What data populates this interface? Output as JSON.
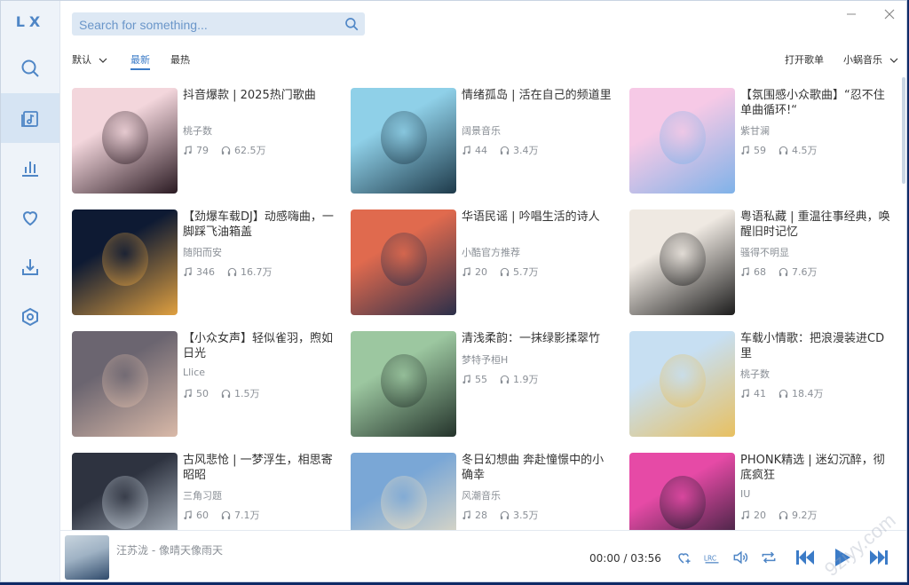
{
  "app": {
    "logo": "LX"
  },
  "sidebar": {
    "items": [
      {
        "icon": "search-icon"
      },
      {
        "icon": "song-list-icon",
        "active": true
      },
      {
        "icon": "chart-icon"
      },
      {
        "icon": "heart-icon"
      },
      {
        "icon": "download-icon"
      },
      {
        "icon": "settings-icon"
      }
    ]
  },
  "search": {
    "placeholder": "Search for something..."
  },
  "toolbar": {
    "sort_label": "默认",
    "tab_new": "最新",
    "tab_hot": "最热",
    "open_list": "打开歌单",
    "source": "小蜗音乐"
  },
  "playlists": [
    {
      "title": "抖音爆款 | 2025热门歌曲",
      "author": "桃子数",
      "songs": "79",
      "plays": "62.5万",
      "colors": [
        "#f3d6dc",
        "#2a1a22"
      ]
    },
    {
      "title": "情绪孤岛 | 活在自己的频道里",
      "author": "阔景音乐",
      "songs": "44",
      "plays": "3.4万",
      "colors": [
        "#8fd0e8",
        "#1e3a4a"
      ]
    },
    {
      "title": "【氛围感小众歌曲】“忍不住单曲循环!“",
      "author": "紫甘澜",
      "songs": "59",
      "plays": "4.5万",
      "colors": [
        "#f6c9e6",
        "#7fb2e8"
      ]
    },
    {
      "title": "【劲爆车载DJ】动感嗨曲，一脚踩飞油箱盖",
      "author": "随阳而安",
      "songs": "346",
      "plays": "16.7万",
      "colors": [
        "#0e1a33",
        "#e0a040"
      ]
    },
    {
      "title": "华语民谣 | 吟唱生活的诗人",
      "author": "小酷官方推荐",
      "songs": "20",
      "plays": "5.7万",
      "colors": [
        "#e06a4e",
        "#2b2f4a"
      ]
    },
    {
      "title": "粤语私藏 | 重温往事经典，唤醒旧时记忆",
      "author": "骚得不明显",
      "songs": "68",
      "plays": "7.6万",
      "colors": [
        "#efe9e2",
        "#1c1c1c"
      ]
    },
    {
      "title": "【小众女声】轻似雀羽，煦如日光",
      "author": "Llice",
      "songs": "50",
      "plays": "1.5万",
      "colors": [
        "#6b6570",
        "#d9b9a8"
      ]
    },
    {
      "title": "清浅柔韵：一抹绿影揉翠竹",
      "author": "梦特予桓H",
      "songs": "55",
      "plays": "1.9万",
      "colors": [
        "#9cc7a0",
        "#24332b"
      ]
    },
    {
      "title": "车载小情歌：把浪漫装进CD里",
      "author": "桃子数",
      "songs": "41",
      "plays": "18.4万",
      "colors": [
        "#c7dff2",
        "#e8c060"
      ]
    },
    {
      "title": "古风悲怆 | 一梦浮生，相思寄昭昭",
      "author": "三角习题",
      "songs": "60",
      "plays": "7.1万",
      "colors": [
        "#2e3340",
        "#c8d2dc"
      ]
    },
    {
      "title": "冬日幻想曲 奔赴憧憬中的小确幸",
      "author": "风潮音乐",
      "songs": "28",
      "plays": "3.5万",
      "colors": [
        "#7aa7d6",
        "#f2e2c2"
      ]
    },
    {
      "title": "PHONK精选 | 迷幻沉醉，彻底疯狂",
      "author": "IU",
      "songs": "20",
      "plays": "9.2万",
      "colors": [
        "#e64aa6",
        "#1a1a2a"
      ]
    }
  ],
  "player": {
    "track": "汪苏泷 - 像晴天像雨天",
    "time_current": "00:00",
    "time_separator": "/",
    "time_total": "03:56"
  },
  "watermark": "9ziyy.com"
}
